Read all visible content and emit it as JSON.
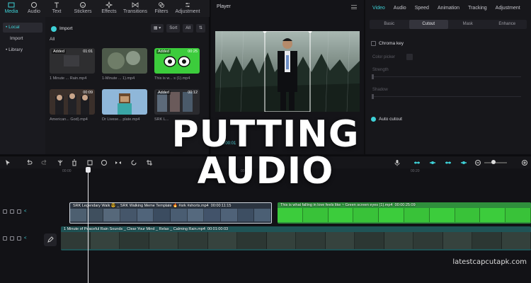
{
  "toolbar": {
    "items": [
      {
        "label": "Media",
        "icon": "media-icon",
        "active": true
      },
      {
        "label": "Audio",
        "icon": "audio-icon"
      },
      {
        "label": "Text",
        "icon": "text-icon"
      },
      {
        "label": "Stickers",
        "icon": "stickers-icon"
      },
      {
        "label": "Effects",
        "icon": "effects-icon"
      },
      {
        "label": "Transitions",
        "icon": "transitions-icon"
      },
      {
        "label": "Filters",
        "icon": "filters-icon"
      },
      {
        "label": "Adjustment",
        "icon": "adjustment-icon"
      }
    ],
    "accent": "#3ed0d6"
  },
  "media_panel": {
    "nav": [
      "• Local",
      "Import",
      "• Library"
    ],
    "import_label": "Import",
    "sort_label": "Sort",
    "all_filter": "All",
    "all_label": "All",
    "clips": [
      {
        "badge": "Added",
        "duration": "01:01",
        "name": "1 Minute ... Rain.mp4"
      },
      {
        "badge": "",
        "duration": "",
        "name": "1-Minute ... 1).mp4"
      },
      {
        "badge": "Added",
        "duration": "00:25",
        "name": "This is w... s (1).mp4"
      },
      {
        "badge": "",
        "duration": "00:09",
        "name": "American... God).mp4"
      },
      {
        "badge": "",
        "duration": "",
        "name": "Dr Livese... plate.mp4"
      },
      {
        "badge": "Added",
        "duration": "00:12",
        "name": "SRK L..."
      }
    ]
  },
  "player": {
    "title": "Player",
    "timecode": "00:00:01"
  },
  "inspector": {
    "tabs": [
      "Video",
      "Audio",
      "Speed",
      "Animation",
      "Tracking",
      "Adjustment"
    ],
    "subtabs": [
      "Basic",
      "Cutout",
      "Mask",
      "Enhance"
    ],
    "chroma_key": "Chroma key",
    "color_picker": "Color picker",
    "strength": "Strength",
    "shadow": "Shadow",
    "auto_cutout": "Auto cutout"
  },
  "timeline": {
    "ruler": [
      "00:00",
      "00:10",
      "00:20"
    ],
    "clips": {
      "srk": {
        "title": "SRK Legendary Walk 😎 _ SRK Walking Meme Template 🔥 #srk #shorts.mp4",
        "duration": "00:00:11:15"
      },
      "green": {
        "title": "This is what falling in love feels like ~ Green screen eyes (1).mp4",
        "duration": "00:00:25:09"
      },
      "rain": {
        "title": "1 Minute of Peaceful Rain Sounds _ Clear Your Mind _ Relax _ Calming Rain.mp4",
        "duration": "00:01:00:03"
      }
    }
  },
  "overlay": {
    "line1": "PUTTING",
    "line2": "AUDIO"
  },
  "watermark": "latestcapcutapk.com"
}
